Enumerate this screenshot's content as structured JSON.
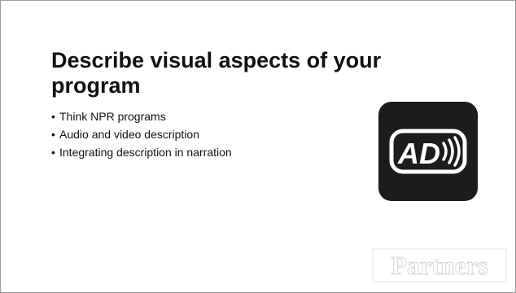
{
  "slide": {
    "title": "Describe visual aspects of your program",
    "bullets": [
      "Think NPR programs",
      "Audio and video description",
      "Integrating description in narration"
    ],
    "bullet_char": "•",
    "logo_text": "AD",
    "watermark_text": "Partners"
  },
  "colors": {
    "background": "#ffffff",
    "text": "#111111",
    "logo_background": "#1c1c1c",
    "logo_foreground": "#ffffff",
    "watermark": "#d6d6d6"
  },
  "icons": {
    "ad_logo": "audio-description-icon",
    "watermark": "partners-watermark"
  }
}
